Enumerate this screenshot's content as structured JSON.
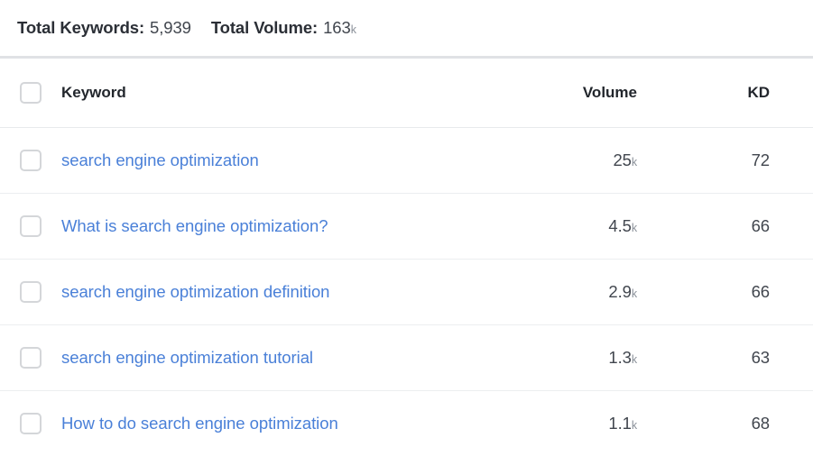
{
  "summary": {
    "keywords_label": "Total Keywords:",
    "keywords_value": "5,939",
    "volume_label": "Total Volume:",
    "volume_value": "163",
    "volume_unit": "k"
  },
  "table": {
    "headers": {
      "keyword": "Keyword",
      "volume": "Volume",
      "kd": "KD"
    },
    "rows": [
      {
        "keyword": "search engine optimization",
        "volume": "25",
        "volume_unit": "k",
        "kd": "72"
      },
      {
        "keyword": "What is search engine optimization?",
        "volume": "4.5",
        "volume_unit": "k",
        "kd": "66"
      },
      {
        "keyword": "search engine optimization definition",
        "volume": "2.9",
        "volume_unit": "k",
        "kd": "66"
      },
      {
        "keyword": "search engine optimization tutorial",
        "volume": "1.3",
        "volume_unit": "k",
        "kd": "63"
      },
      {
        "keyword": "How to do search engine optimization",
        "volume": "1.1",
        "volume_unit": "k",
        "kd": "68"
      }
    ]
  },
  "colors": {
    "link": "#4a80d8",
    "text": "#41464e",
    "heading": "#22262c",
    "divider": "#e0e2e5",
    "row_border": "#eceef0",
    "checkbox_border": "#d4d6d9"
  }
}
